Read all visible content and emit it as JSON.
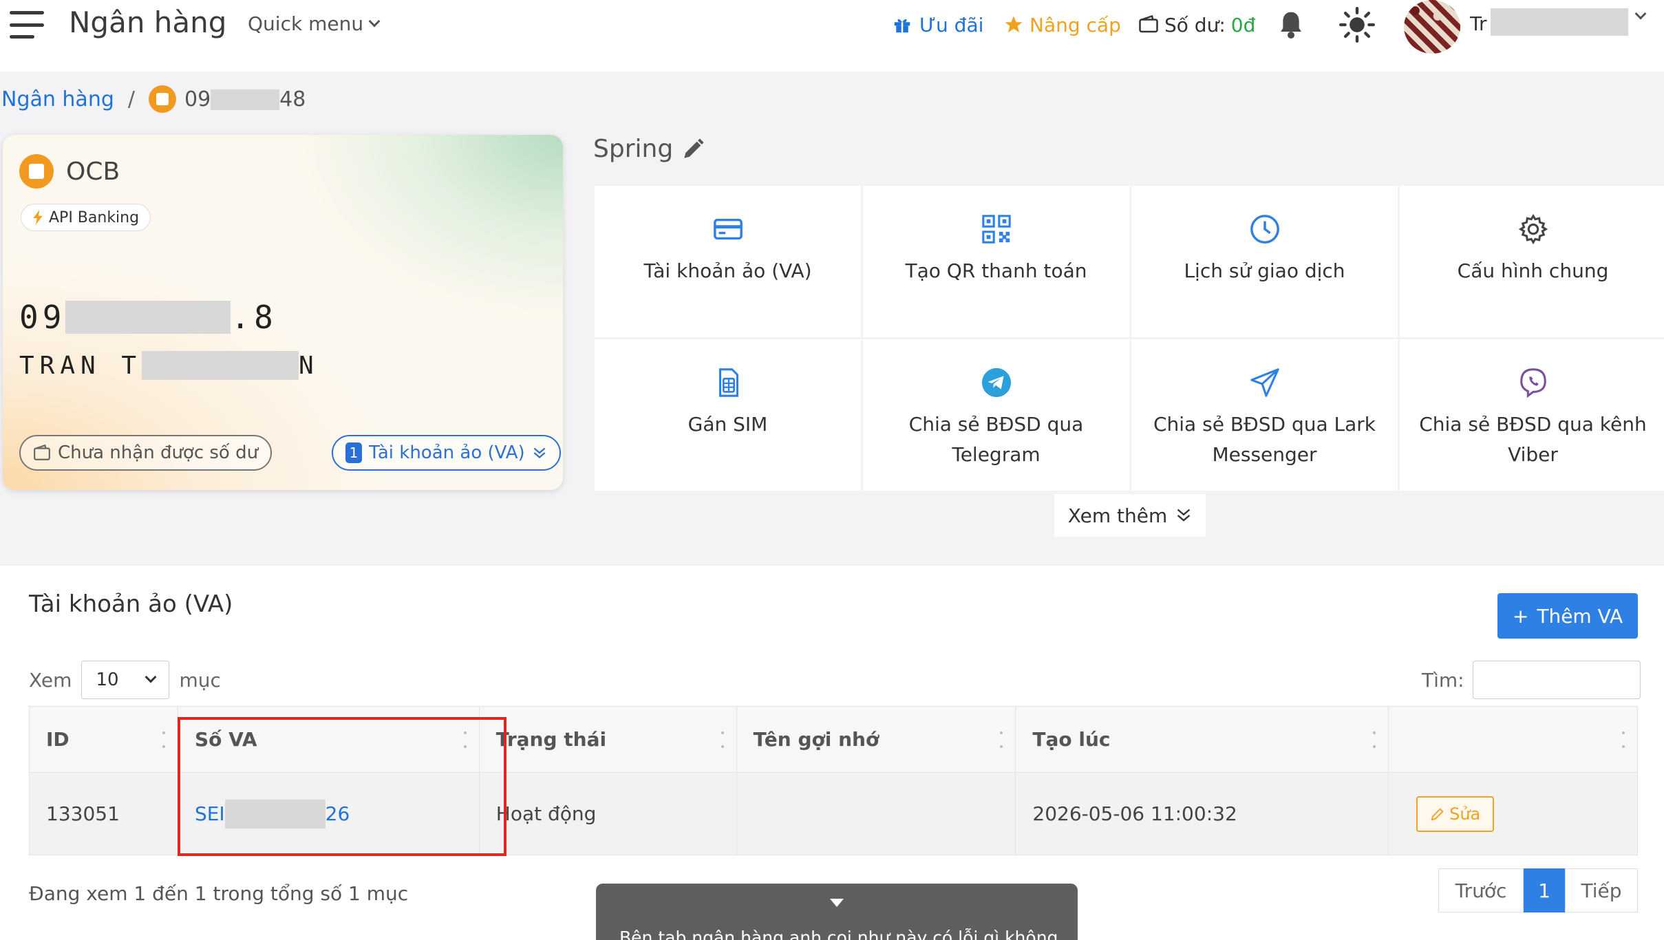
{
  "header": {
    "brand": "Ngân hàng",
    "quick_menu": "Quick menu",
    "promo": "Ưu đãi",
    "upgrade": "Nâng cấp",
    "balance_label": "Số dư:",
    "balance_value": "0đ",
    "user_prefix": "Tr"
  },
  "breadcrumb": {
    "root": "Ngân hàng",
    "separator": "/",
    "acct_prefix": "09",
    "acct_suffix": "48"
  },
  "card": {
    "bank_name": "OCB",
    "badge": "API Banking",
    "number_prefix": "09",
    "number_suffix": ".8",
    "name_prefix": "TRAN T",
    "name_suffix": "N",
    "balance_pill": "Chưa nhận được số dư",
    "va_count": "1",
    "va_pill": "Tài khoản ảo (VA)"
  },
  "spring": {
    "title": "Spring"
  },
  "tiles": [
    {
      "label": "Tài khoản ảo (VA)",
      "icon": "credit-card-icon"
    },
    {
      "label": "Tạo QR thanh toán",
      "icon": "qr-code-icon"
    },
    {
      "label": "Lịch sử giao dịch",
      "icon": "clock-icon"
    },
    {
      "label": "Cấu hình chung",
      "icon": "gear-icon"
    },
    {
      "label": "Gán SIM",
      "icon": "sim-card-icon"
    },
    {
      "label": "Chia sẻ BĐSD qua Telegram",
      "icon": "telegram-icon"
    },
    {
      "label": "Chia sẻ BĐSD qua Lark Messenger",
      "icon": "send-icon"
    },
    {
      "label": "Chia sẻ BĐSD qua kênh Viber",
      "icon": "viber-icon"
    }
  ],
  "see_more": "Xem thêm",
  "va_section": {
    "title": "Tài khoản ảo (VA)",
    "add_button": "Thêm VA",
    "show_label": "Xem",
    "page_size": "10",
    "entries_label": "mục",
    "search_label": "Tìm:",
    "columns": [
      "ID",
      "Số VA",
      "Trạng thái",
      "Tên gợi nhớ",
      "Tạo lúc",
      ""
    ],
    "rows": [
      {
        "id": "133051",
        "va_prefix": "SEI",
        "va_suffix": "26",
        "status": "Hoạt động",
        "alias": "",
        "created": "2026-05-06 11:00:32",
        "action": "Sửa"
      }
    ],
    "info": "Đang xem 1 đến 1 trong tổng số 1 mục",
    "pager": {
      "prev": "Trước",
      "current": "1",
      "next": "Tiếp"
    }
  },
  "tooltip": {
    "text": "Bên tab ngân hàng anh coi như này có lỗi gì không"
  },
  "colors": {
    "accent": "#2f80e4",
    "link": "#1f73d8",
    "success": "#3bb34a",
    "warning": "#f0a21e",
    "highlight": "#e0271e"
  }
}
